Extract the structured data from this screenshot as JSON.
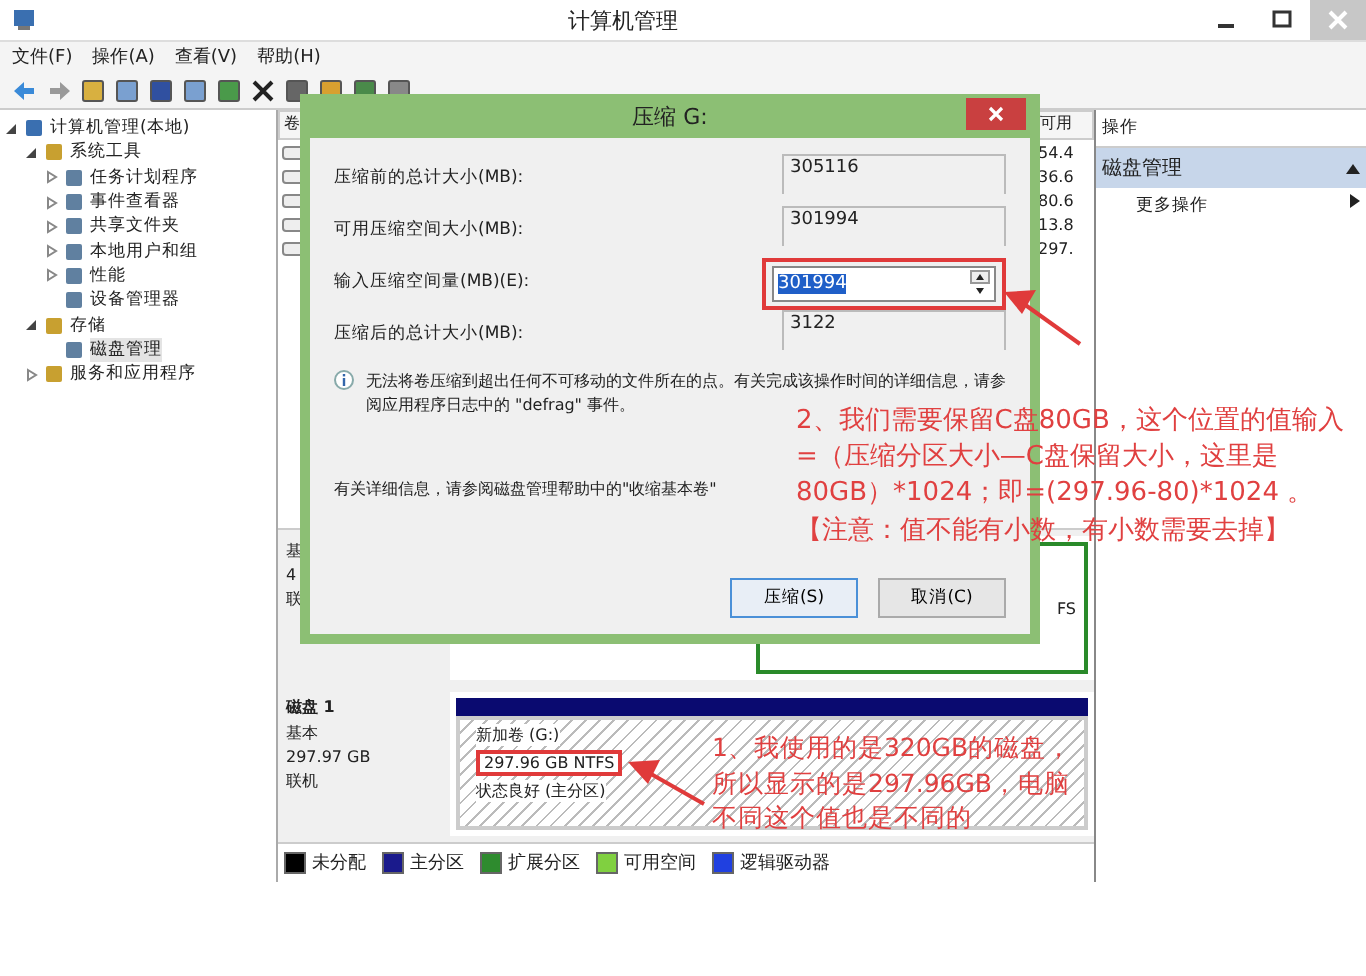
{
  "window": {
    "title": "计算机管理"
  },
  "menu": [
    "文件(F)",
    "操作(A)",
    "查看(V)",
    "帮助(H)"
  ],
  "tree": [
    {
      "label": "计算机管理(本地)",
      "expanded": true,
      "selected": false,
      "children": [
        {
          "label": "系统工具",
          "expanded": true,
          "selected": false,
          "children": [
            {
              "label": "任务计划程序",
              "expanded": false,
              "selected": false
            },
            {
              "label": "事件查看器",
              "expanded": false,
              "selected": false
            },
            {
              "label": "共享文件夹",
              "expanded": false,
              "selected": false
            },
            {
              "label": "本地用户和组",
              "expanded": false,
              "selected": false
            },
            {
              "label": "性能",
              "expanded": false,
              "selected": false
            },
            {
              "label": "设备管理器",
              "selected": false
            }
          ]
        },
        {
          "label": "存储",
          "expanded": true,
          "selected": false,
          "children": [
            {
              "label": "磁盘管理",
              "selected": true
            }
          ]
        },
        {
          "label": "服务和应用程序",
          "expanded": false,
          "selected": false
        }
      ]
    }
  ],
  "volume_list": {
    "columns": [
      "卷",
      "可用"
    ],
    "free_values": [
      "54.4",
      "36.6",
      "80.6",
      "13.8",
      "297."
    ]
  },
  "disk0": {
    "lines": [
      "基",
      "4",
      "联"
    ],
    "partition_texts": [
      "FS"
    ]
  },
  "disk1": {
    "name": "磁盘 1",
    "type": "基本",
    "size": "297.97 GB",
    "status": "联机",
    "partition": {
      "name": "新加卷 (G:)",
      "size": "297.96 GB NTFS",
      "state": "状态良好 (主分区)"
    }
  },
  "legend": [
    {
      "label": "未分配",
      "color": "#000000"
    },
    {
      "label": "主分区",
      "color": "#1a1a8c"
    },
    {
      "label": "扩展分区",
      "color": "#2e8b2e"
    },
    {
      "label": "可用空间",
      "color": "#80d040"
    },
    {
      "label": "逻辑驱动器",
      "color": "#2040e0"
    }
  ],
  "actions": {
    "header": "操作",
    "section": "磁盘管理",
    "items": [
      "更多操作"
    ]
  },
  "dialog": {
    "title": "压缩 G:",
    "fields": [
      {
        "label": "压缩前的总计大小(MB):",
        "value": "305116",
        "kind": "readonly"
      },
      {
        "label": "可用压缩空间大小(MB):",
        "value": "301994",
        "kind": "readonly"
      },
      {
        "label": "输入压缩空间量(MB)(E):",
        "value": "301994",
        "kind": "spin"
      },
      {
        "label": "压缩后的总计大小(MB):",
        "value": "3122",
        "kind": "readonly"
      }
    ],
    "info": "无法将卷压缩到超出任何不可移动的文件所在的点。有关完成该操作时间的详细信息，请参阅应用程序日志中的 \"defrag\" 事件。",
    "help": "有关详细信息，请参阅磁盘管理帮助中的\"收缩基本卷\"",
    "buttons": [
      {
        "label": "压缩(S)",
        "default": true
      },
      {
        "label": "取消(C)",
        "default": false
      }
    ]
  },
  "annotations": [
    {
      "text": "2、我们需要保留C盘80GB，这个位置的值输入=（压缩分区大小—C盘保留大小，这里是80GB）*1024；即=(297.96-80)*1024 。",
      "note": "【注意：值不能有小数，有小数需要去掉】"
    },
    {
      "text": "1、我使用的是320GB的磁盘，所以显示的是297.96GB，电脑不同这个值也是不同的"
    }
  ]
}
